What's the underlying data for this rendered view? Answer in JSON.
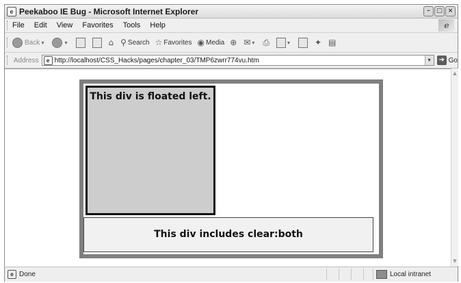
{
  "window": {
    "title": "Peekaboo IE Bug - Microsoft Internet Explorer",
    "icon": "ie-icon",
    "buttons": [
      "minimize",
      "maximize",
      "close"
    ]
  },
  "menubar": {
    "items": [
      "File",
      "Edit",
      "View",
      "Favorites",
      "Tools",
      "Help"
    ]
  },
  "toolbar": {
    "back_label": "Back",
    "search_label": "Search",
    "favorites_label": "Favorites",
    "media_label": "Media"
  },
  "addressbar": {
    "label": "Address",
    "url": "http://localhost/CSS_Hacks/pages/chapter_03/TMP6zwrr774vu.htm",
    "go_label": "Go"
  },
  "page": {
    "float_text": "This div is floated left.",
    "clear_text": "This div includes clear:both"
  },
  "statusbar": {
    "status_text": "Done",
    "zone_text": "Local intranet"
  }
}
